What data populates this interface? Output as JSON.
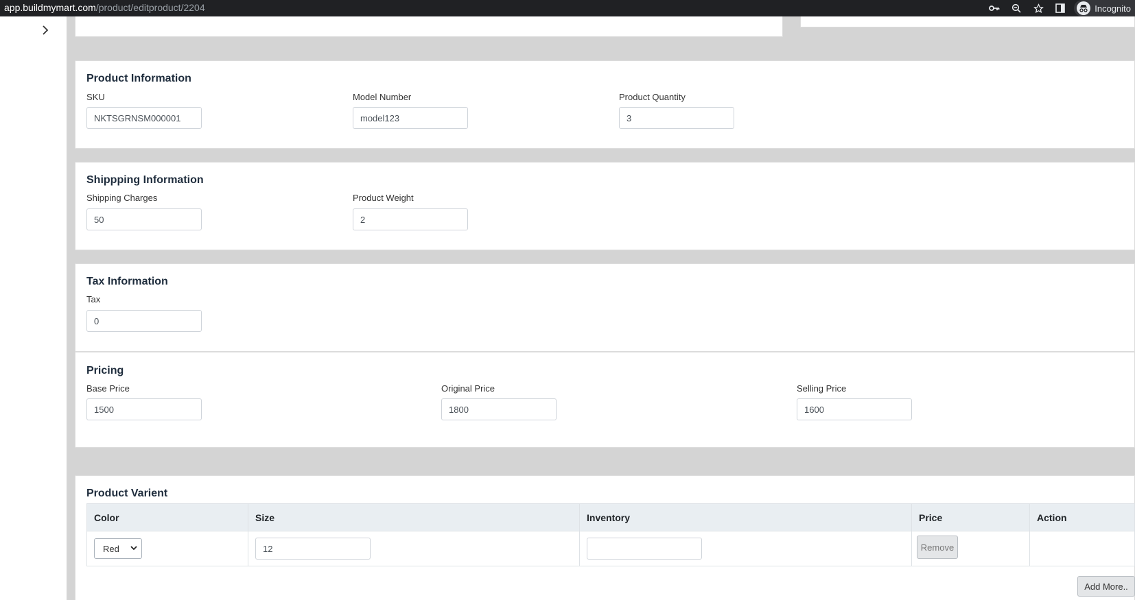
{
  "browser": {
    "url_host": "app.buildmymart.com",
    "url_path": "/product/editproduct/2204",
    "incognito_label": "Incognito",
    "icons": [
      "key-icon",
      "zoom-icon",
      "star-icon",
      "sidepanel-icon",
      "incognito-icon"
    ]
  },
  "sidebar": {
    "toggle_icon": "chevron-right-icon"
  },
  "product_info": {
    "title": "Product Information",
    "sku_label": "SKU",
    "sku_value": "NKTSGRNSM000001",
    "model_label": "Model Number",
    "model_value": "model123",
    "qty_label": "Product Quantity",
    "qty_value": "3"
  },
  "shipping_info": {
    "title": "Shippping Information",
    "charges_label": "Shipping Charges",
    "charges_value": "50",
    "weight_label": "Product Weight",
    "weight_value": "2"
  },
  "tax_info": {
    "title": "Tax Information",
    "tax_label": "Tax",
    "tax_value": "0"
  },
  "pricing": {
    "title": "Pricing",
    "base_label": "Base Price",
    "base_value": "1500",
    "original_label": "Original Price",
    "original_value": "1800",
    "selling_label": "Selling Price",
    "selling_value": "1600"
  },
  "variant": {
    "title": "Product Varient",
    "columns": [
      "Color",
      "Size",
      "Inventory",
      "Price",
      "Action"
    ],
    "rows": [
      {
        "color": "Red",
        "size": "12",
        "inventory": "",
        "remove_label": "Remove"
      }
    ],
    "add_more_label": "Add More.."
  }
}
